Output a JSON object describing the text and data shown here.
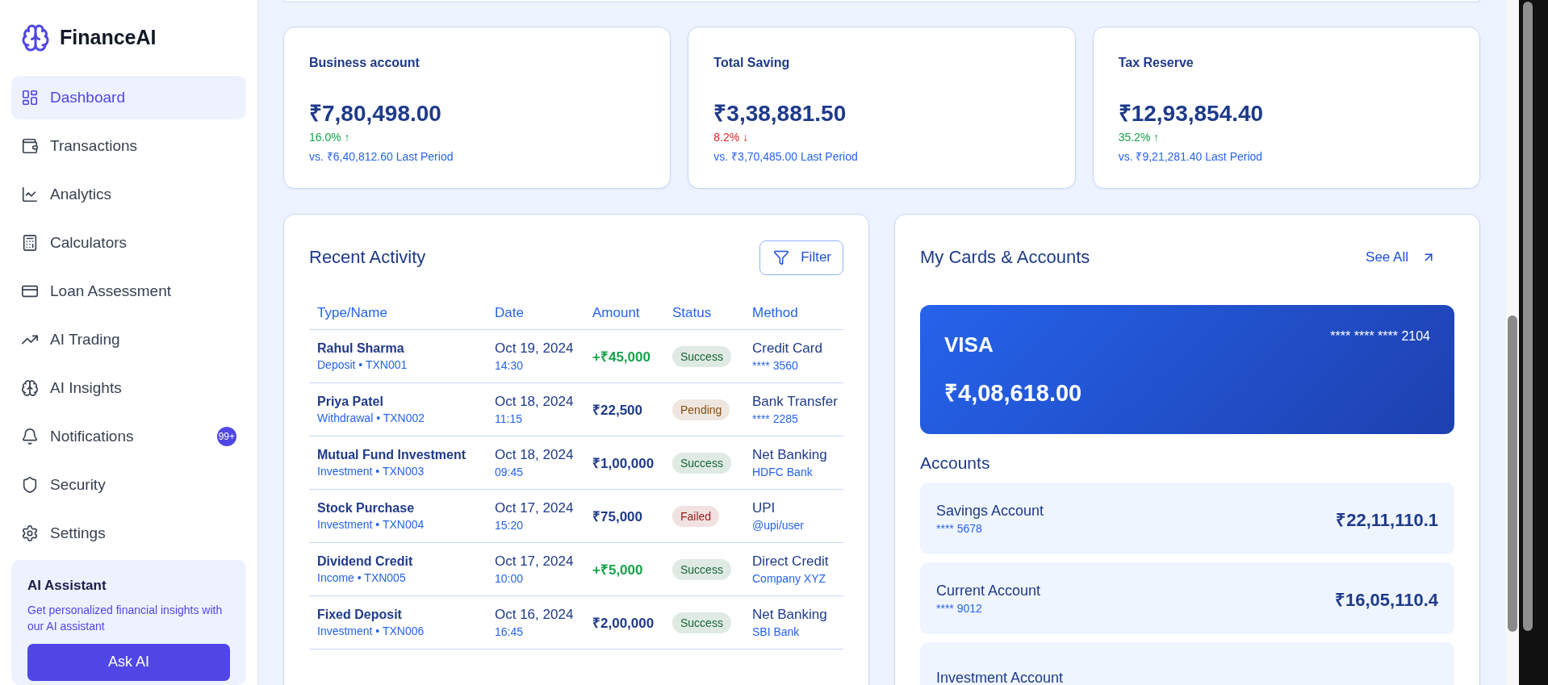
{
  "sidebar": {
    "brand": "FinanceAI",
    "items": [
      {
        "label": "Dashboard",
        "selected": true
      },
      {
        "label": "Transactions",
        "selected": false
      },
      {
        "label": "Analytics",
        "selected": false
      },
      {
        "label": "Calculators",
        "selected": false
      },
      {
        "label": "Loan Assessment",
        "selected": false
      },
      {
        "label": "AI Trading",
        "selected": false
      },
      {
        "label": "AI Insights",
        "selected": false
      },
      {
        "label": "Notifications",
        "selected": false,
        "badge": "99+"
      },
      {
        "label": "Security",
        "selected": false
      },
      {
        "label": "Settings",
        "selected": false
      }
    ],
    "assistant": {
      "title": "AI Assistant",
      "text": "Get personalized financial insights with our AI assistant",
      "button": "Ask AI"
    }
  },
  "stats": [
    {
      "title": "Business account",
      "value": "₹7,80,498.00",
      "change": "16.0% ↑",
      "rising": true,
      "comparison": "vs. ₹6,40,812.60 Last Period"
    },
    {
      "title": "Total Saving",
      "value": "₹3,38,881.50",
      "change": "8.2% ↓",
      "rising": false,
      "comparison": "vs. ₹3,70,485.00 Last Period"
    },
    {
      "title": "Tax Reserve",
      "value": "₹12,93,854.40",
      "change": "35.2% ↑",
      "rising": true,
      "comparison": "vs. ₹9,21,281.40 Last Period"
    }
  ],
  "activity": {
    "title": "Recent Activity",
    "filter": "Filter",
    "columns": [
      "Type/Name",
      "Date",
      "Amount",
      "Status",
      "Method"
    ],
    "rows": [
      {
        "name": "Rahul Sharma",
        "detail": "Deposit • TXN001",
        "date": "Oct 19, 2024",
        "time": "14:30",
        "amount": "+₹45,000",
        "credit": true,
        "status": {
          "label": "Success",
          "color": "#166534"
        },
        "method": "Credit Card",
        "method_detail": "**** 3560"
      },
      {
        "name": "Priya Patel",
        "detail": "Withdrawal • TXN002",
        "date": "Oct 18, 2024",
        "time": "11:15",
        "amount": "₹22,500",
        "credit": false,
        "status": {
          "label": "Pending",
          "color": "#854d0e"
        },
        "method": "Bank Transfer",
        "method_detail": "**** 2285"
      },
      {
        "name": "Mutual Fund Investment",
        "detail": "Investment • TXN003",
        "date": "Oct 18, 2024",
        "time": "09:45",
        "amount": "₹1,00,000",
        "credit": false,
        "status": {
          "label": "Success",
          "color": "#166534"
        },
        "method": "Net Banking",
        "method_detail": "HDFC Bank"
      },
      {
        "name": "Stock Purchase",
        "detail": "Investment • TXN004",
        "date": "Oct 17, 2024",
        "time": "15:20",
        "amount": "₹75,000",
        "credit": false,
        "status": {
          "label": "Failed",
          "color": "#991b1b"
        },
        "method": "UPI",
        "method_detail": "@upi/user"
      },
      {
        "name": "Dividend Credit",
        "detail": "Income • TXN005",
        "date": "Oct 17, 2024",
        "time": "10:00",
        "amount": "+₹5,000",
        "credit": true,
        "status": {
          "label": "Success",
          "color": "#166534"
        },
        "method": "Direct Credit",
        "method_detail": "Company XYZ"
      },
      {
        "name": "Fixed Deposit",
        "detail": "Investment • TXN006",
        "date": "Oct 16, 2024",
        "time": "16:45",
        "amount": "₹2,00,000",
        "credit": false,
        "status": {
          "label": "Success",
          "color": "#166534"
        },
        "method": "Net Banking",
        "method_detail": "SBI Bank"
      }
    ]
  },
  "cards": {
    "title": "My Cards & Accounts",
    "see_all": "See All",
    "card": {
      "brand": "VISA",
      "number": "**** **** **** 2104",
      "balance": "₹4,08,618.00"
    },
    "accounts_title": "Accounts",
    "accounts": [
      {
        "name": "Savings Account",
        "number": "**** 5678",
        "balance": "₹22,11,110.1"
      },
      {
        "name": "Current Account",
        "number": "**** 9012",
        "balance": "₹16,05,110.4"
      },
      {
        "name": "Investment Account"
      }
    ]
  }
}
